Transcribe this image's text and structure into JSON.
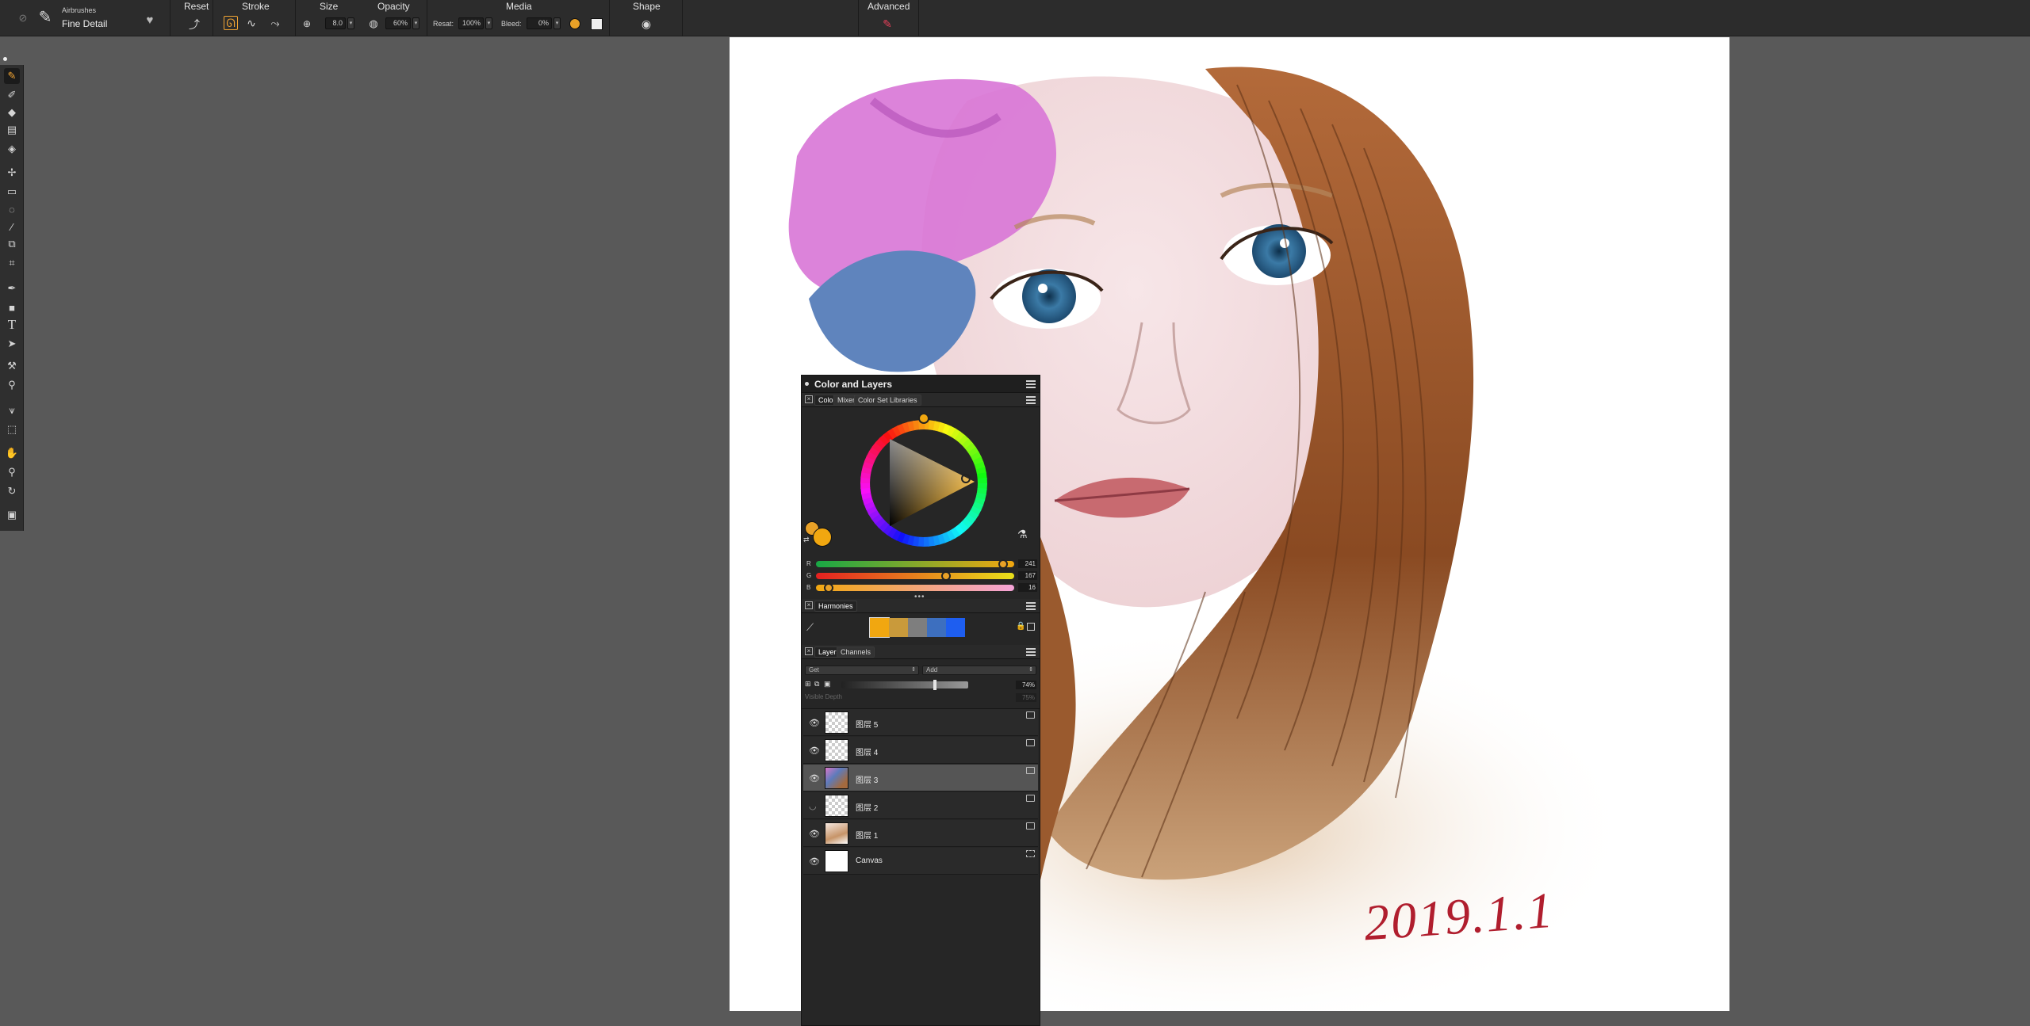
{
  "brush": {
    "category": "Airbrushes",
    "variant": "Fine Detail"
  },
  "toolbar": {
    "reset_label": "Reset",
    "stroke_label": "Stroke",
    "size_label": "Size",
    "size_value": "8.0",
    "opacity_label": "Opacity",
    "opacity_value": "60%",
    "media_label": "Media",
    "resat_label": "Resat:",
    "resat_value": "100%",
    "bleed_label": "Bleed:",
    "bleed_value": "0%",
    "shape_label": "Shape",
    "advanced_label": "Advanced"
  },
  "panel": {
    "title": "Color and Layers",
    "color_tabs": [
      "Color",
      "Mixer",
      "Color Set Libraries"
    ],
    "rgb": [
      {
        "label": "R",
        "value": "241",
        "fraction": 0.945
      },
      {
        "label": "G",
        "value": "167",
        "fraction": 0.655
      },
      {
        "label": "B",
        "value": "16",
        "fraction": 0.063
      }
    ],
    "main_color": "#f1a710",
    "harmonies_label": "Harmonies",
    "harmony_swatches": [
      "#f1a710",
      "#c99a3b",
      "#7e7e7e",
      "#3d6fbf",
      "#1e5ef0"
    ],
    "layers_tabs": [
      "Layers",
      "Channels"
    ],
    "composite_method": "Get",
    "composite_depth": "Add",
    "opacity_value": "74%",
    "visible_depth_label": "Visible Depth",
    "visible_depth_value": "75%",
    "layers": [
      {
        "name": "图层 5",
        "visible": true,
        "selected": false
      },
      {
        "name": "图层 4",
        "visible": true,
        "selected": false
      },
      {
        "name": "图层 3",
        "visible": true,
        "selected": true
      },
      {
        "name": "图层 2",
        "visible": false,
        "selected": false
      },
      {
        "name": "图层 1",
        "visible": true,
        "selected": false
      },
      {
        "name": "Canvas",
        "visible": true,
        "selected": false
      }
    ]
  },
  "canvas": {
    "signature": "2019.1.1"
  }
}
